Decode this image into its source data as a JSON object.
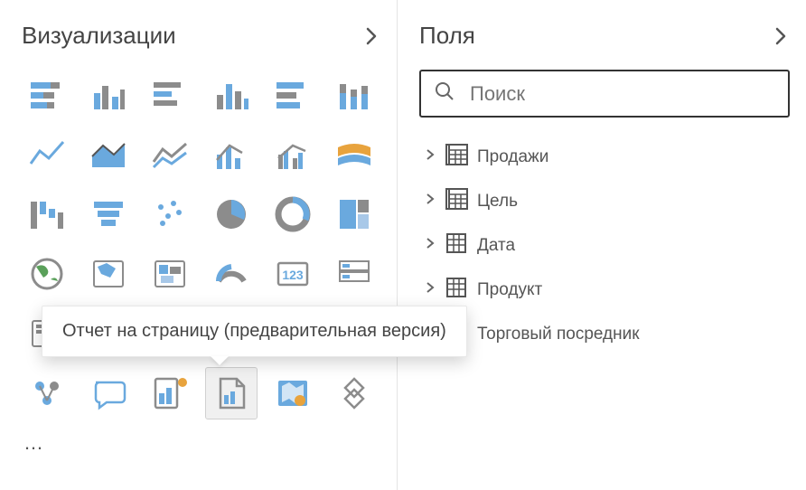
{
  "viz_panel": {
    "title": "Визуализации",
    "tooltip": "Отчет на страницу (предварительная версия)",
    "more": "…",
    "icons": [
      {
        "name": "stacked-bar-icon"
      },
      {
        "name": "clustered-column-icon"
      },
      {
        "name": "stacked-bar-h-icon"
      },
      {
        "name": "column-icon"
      },
      {
        "name": "stacked-column-icon"
      },
      {
        "name": "clustered-bar-icon"
      },
      {
        "name": "line-icon"
      },
      {
        "name": "area-icon"
      },
      {
        "name": "stacked-area-icon"
      },
      {
        "name": "line-column-icon"
      },
      {
        "name": "line-clustered-icon"
      },
      {
        "name": "ribbon-icon"
      },
      {
        "name": "waterfall-icon"
      },
      {
        "name": "funnel-icon"
      },
      {
        "name": "scatter-icon"
      },
      {
        "name": "pie-icon"
      },
      {
        "name": "donut-icon"
      },
      {
        "name": "treemap-icon"
      },
      {
        "name": "globe-icon"
      },
      {
        "name": "filled-map-icon"
      },
      {
        "name": "shape-map-icon"
      },
      {
        "name": "gauge-icon"
      },
      {
        "name": "card-icon"
      },
      {
        "name": "multirow-card-icon"
      },
      {
        "name": "kpi-icon"
      },
      {
        "name": "slicer-icon"
      },
      {
        "name": "table-icon"
      },
      {
        "name": "matrix-icon"
      },
      {
        "name": "r-visual-icon"
      },
      {
        "name": "py-visual-icon"
      },
      {
        "name": "key-influencers-icon"
      },
      {
        "name": "qa-icon"
      },
      {
        "name": "decomposition-icon"
      },
      {
        "name": "paginated-report-icon"
      },
      {
        "name": "arcgis-icon"
      },
      {
        "name": "custom-visual-icon"
      }
    ]
  },
  "fields_panel": {
    "title": "Поля",
    "search_placeholder": "Поиск",
    "tables": [
      {
        "label": "Продажи",
        "icon": "calc-table-icon"
      },
      {
        "label": "Цель",
        "icon": "calc-table-icon"
      },
      {
        "label": "Дата",
        "icon": "table-icon"
      },
      {
        "label": "Продукт",
        "icon": "table-icon"
      },
      {
        "label": "Торговый посредник",
        "icon": "table-icon"
      }
    ]
  }
}
